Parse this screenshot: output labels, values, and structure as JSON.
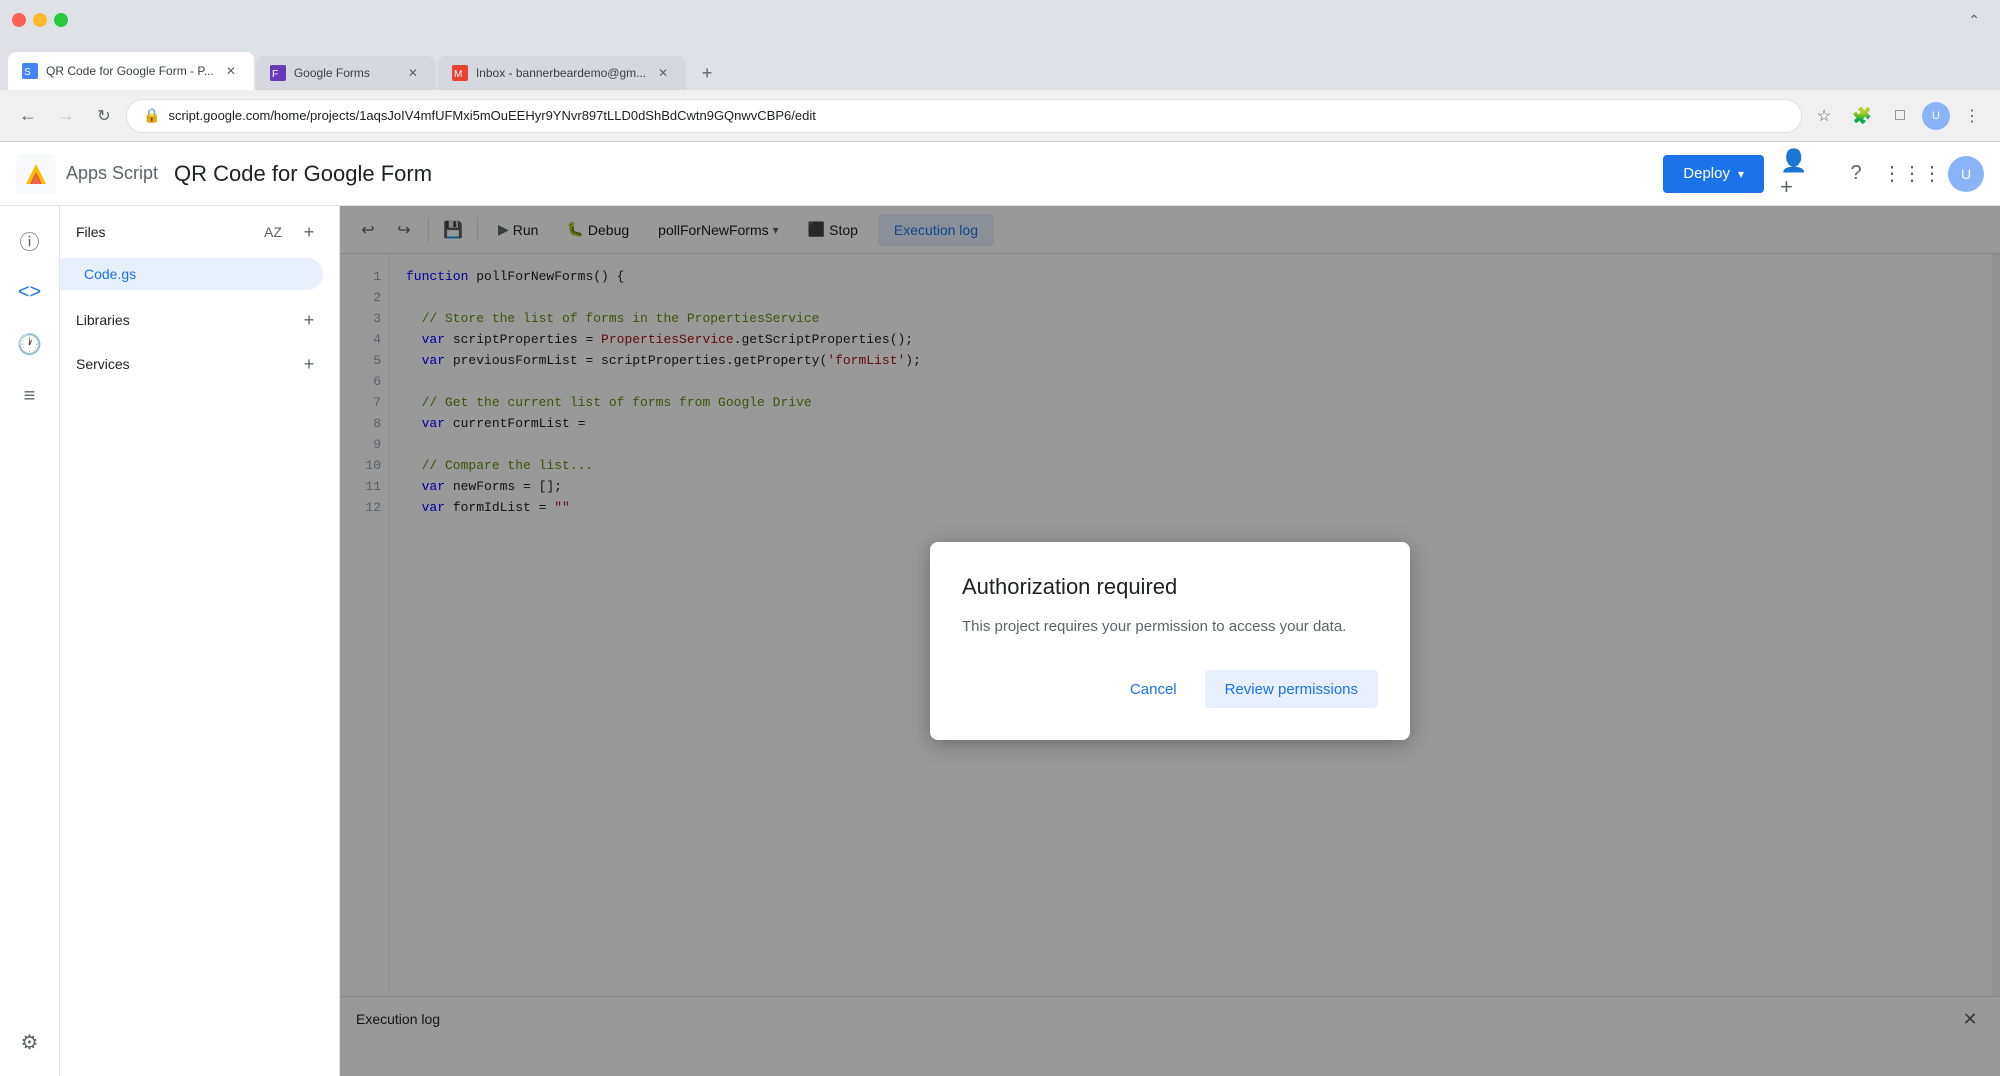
{
  "browser": {
    "tabs": [
      {
        "id": "tab1",
        "title": "QR Code for Google Form - P...",
        "icon": "script-icon",
        "active": true,
        "closeable": true
      },
      {
        "id": "tab2",
        "title": "Google Forms",
        "icon": "forms-icon",
        "active": false,
        "closeable": true
      },
      {
        "id": "tab3",
        "title": "Inbox - bannerbeardemo@gm...",
        "icon": "gmail-icon",
        "active": false,
        "closeable": true
      }
    ],
    "address": "script.google.com/home/projects/1aqsJoIV4mfUFMxi5mOuEEHyr9YNvr897tLLD0dShBdCwtn9GQnwvCBP6/edit"
  },
  "header": {
    "app_name": "Apps Script",
    "project_name": "QR Code for Google Form",
    "deploy_label": "Deploy"
  },
  "toolbar": {
    "run_label": "Run",
    "debug_label": "Debug",
    "function_name": "pollForNewForms",
    "stop_label": "Stop",
    "exec_log_label": "Execution log"
  },
  "sidebar": {
    "files_label": "Files",
    "active_file": "Code.gs",
    "sections": [
      {
        "label": "Libraries",
        "id": "libraries"
      },
      {
        "label": "Services",
        "id": "services"
      }
    ]
  },
  "code": {
    "lines": [
      {
        "num": 1,
        "content": "function pollForNewForms() {",
        "tokens": [
          {
            "type": "kw",
            "text": "function"
          },
          {
            "type": "plain",
            "text": " pollForNewForms() {"
          }
        ]
      },
      {
        "num": 2,
        "content": "",
        "tokens": []
      },
      {
        "num": 3,
        "content": "  // Store the list of forms in the PropertiesService",
        "tokens": [
          {
            "type": "comment",
            "text": "  // Store the list of forms in the PropertiesService"
          }
        ]
      },
      {
        "num": 4,
        "content": "  var scriptProperties = PropertiesService.getScriptProperties();",
        "tokens": [
          {
            "type": "kw",
            "text": "  var"
          },
          {
            "type": "plain",
            "text": " scriptProperties = "
          },
          {
            "type": "obj",
            "text": "PropertiesService"
          },
          {
            "type": "plain",
            "text": ".getScriptProperties();"
          }
        ]
      },
      {
        "num": 5,
        "content": "  var previousFormList = scriptProperties.getProperty('formList');",
        "tokens": [
          {
            "type": "kw",
            "text": "  var"
          },
          {
            "type": "plain",
            "text": " previousFormList = scriptProperties.getProperty("
          },
          {
            "type": "string",
            "text": "'formList'"
          },
          {
            "type": "plain",
            "text": ");"
          }
        ]
      },
      {
        "num": 6,
        "content": "",
        "tokens": []
      },
      {
        "num": 7,
        "content": "  // Get the current list of forms from Google Drive",
        "tokens": [
          {
            "type": "comment",
            "text": "  // Get the current list of forms from Google Drive"
          }
        ]
      },
      {
        "num": 8,
        "content": "  var currentFormList =",
        "tokens": [
          {
            "type": "kw",
            "text": "  var"
          },
          {
            "type": "plain",
            "text": " currentFormList ="
          }
        ]
      },
      {
        "num": 9,
        "content": "",
        "tokens": []
      },
      {
        "num": 10,
        "content": "  // Compare the list...",
        "tokens": [
          {
            "type": "comment",
            "text": "  // Compare the list..."
          }
        ]
      },
      {
        "num": 11,
        "content": "  var newForms = [];",
        "tokens": [
          {
            "type": "kw",
            "text": "  var"
          },
          {
            "type": "plain",
            "text": " newForms = [];"
          }
        ]
      },
      {
        "num": 12,
        "content": "  var formIdList = \"\"",
        "tokens": [
          {
            "type": "kw",
            "text": "  var"
          },
          {
            "type": "plain",
            "text": " formIdList = "
          },
          {
            "type": "string",
            "text": "\"\""
          }
        ]
      }
    ]
  },
  "execution_log": {
    "title": "Execution log",
    "close_label": "×"
  },
  "modal": {
    "title": "Authorization required",
    "body": "This project requires your permission to access your data.",
    "cancel_label": "Cancel",
    "review_label": "Review permissions"
  }
}
